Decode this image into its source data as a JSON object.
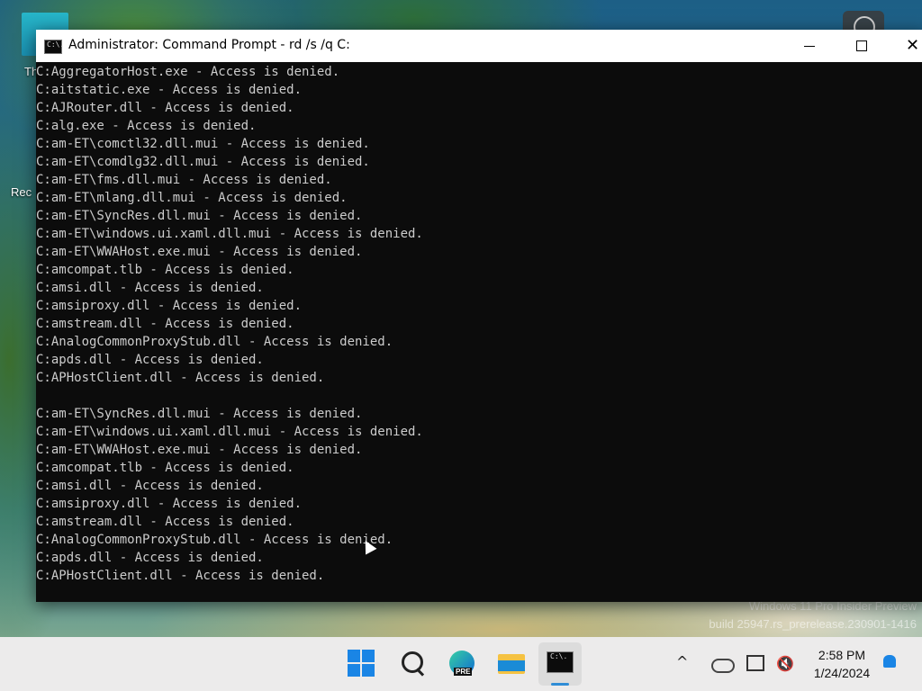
{
  "desktop": {
    "icon_labels": [
      "Th",
      "Rec"
    ],
    "watermark": {
      "line1": "Windows 11 Pro Insider Preview",
      "line2": "build 25947.rs_prerelease.230901-1416"
    }
  },
  "window": {
    "title": "Administrator: Command Prompt - rd  /s /q C:",
    "icon_glyph": "C:\\.",
    "buttons": {
      "minimize": "minimize",
      "maximize": "maximize",
      "close": "✕"
    }
  },
  "terminal": {
    "lines": [
      "C:AggregatorHost.exe - Access is denied.",
      "C:aitstatic.exe - Access is denied.",
      "C:AJRouter.dll - Access is denied.",
      "C:alg.exe - Access is denied.",
      "C:am-ET\\comctl32.dll.mui - Access is denied.",
      "C:am-ET\\comdlg32.dll.mui - Access is denied.",
      "C:am-ET\\fms.dll.mui - Access is denied.",
      "C:am-ET\\mlang.dll.mui - Access is denied.",
      "C:am-ET\\SyncRes.dll.mui - Access is denied.",
      "C:am-ET\\windows.ui.xaml.dll.mui - Access is denied.",
      "C:am-ET\\WWAHost.exe.mui - Access is denied.",
      "C:amcompat.tlb - Access is denied.",
      "C:amsi.dll - Access is denied.",
      "C:amsiproxy.dll - Access is denied.",
      "C:amstream.dll - Access is denied.",
      "C:AnalogCommonProxyStub.dll - Access is denied.",
      "C:apds.dll - Access is denied.",
      "C:APHostClient.dll - Access is denied.",
      "",
      "C:am-ET\\SyncRes.dll.mui - Access is denied.",
      "C:am-ET\\windows.ui.xaml.dll.mui - Access is denied.",
      "C:am-ET\\WWAHost.exe.mui - Access is denied.",
      "C:amcompat.tlb - Access is denied.",
      "C:amsi.dll - Access is denied.",
      "C:amsiproxy.dll - Access is denied.",
      "C:amstream.dll - Access is denied.",
      "C:AnalogCommonProxyStub.dll - Access is denied.",
      "C:apds.dll - Access is denied.",
      "C:APHostClient.dll - Access is denied."
    ]
  },
  "taskbar": {
    "edge_badge": "PRE",
    "cmd_glyph": "C:\\.",
    "clock": {
      "time": "2:58 PM",
      "date": "1/24/2024"
    },
    "tray_chevron": "^"
  },
  "colors": {
    "terminal_bg": "#0c0c0c",
    "terminal_fg": "#cccccc",
    "taskbar_bg": "#ecebeb",
    "accent": "#1a85e5"
  }
}
